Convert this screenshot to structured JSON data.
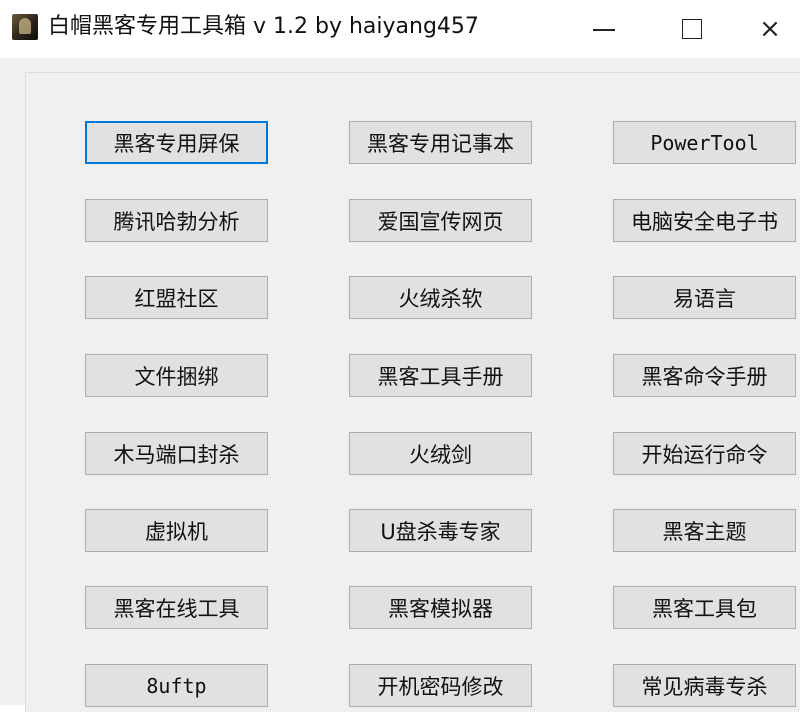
{
  "window": {
    "title": "白帽黑客专用工具箱 v 1.2  by haiyang457",
    "icon": "hacker-portrait-icon"
  },
  "controls": {
    "minimize": "minimize-icon",
    "maximize": "maximize-icon",
    "close": "×"
  },
  "buttons": [
    [
      "黑客专用屏保",
      "黑客专用记事本",
      "PowerTool"
    ],
    [
      "腾讯哈勃分析",
      "爱国宣传网页",
      "电脑安全电子书"
    ],
    [
      "红盟社区",
      "火绒杀软",
      "易语言"
    ],
    [
      "文件捆绑",
      "黑客工具手册",
      "黑客命令手册"
    ],
    [
      "木马端口封杀",
      "火绒剑",
      "开始运行命令"
    ],
    [
      "虚拟机",
      "U盘杀毒专家",
      "黑客主题"
    ],
    [
      "黑客在线工具",
      "黑客模拟器",
      "黑客工具包"
    ],
    [
      "8uftp",
      "开机密码修改",
      "常见病毒专杀"
    ]
  ],
  "focused_button": "黑客专用屏保"
}
